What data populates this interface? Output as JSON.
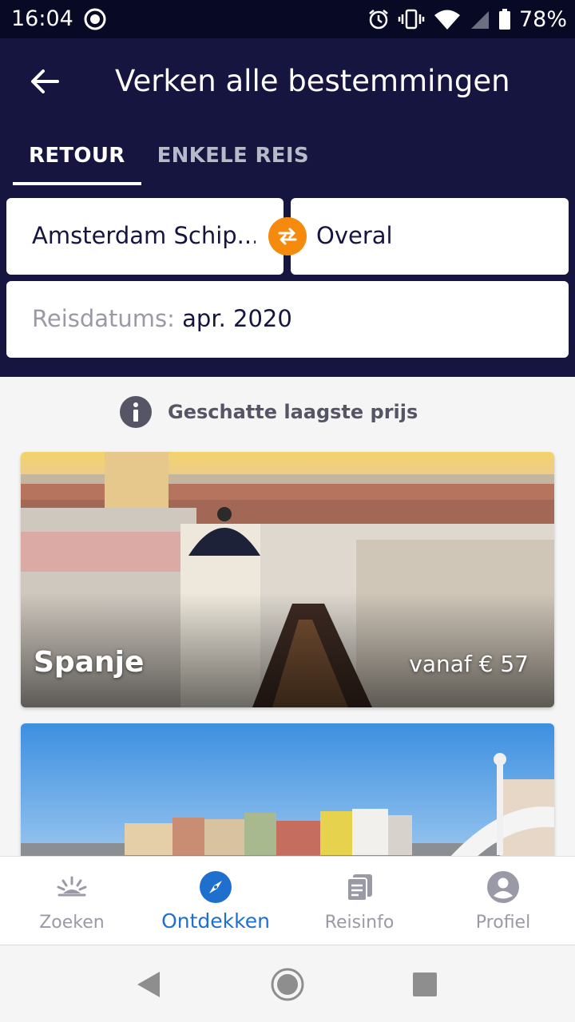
{
  "status_bar": {
    "time": "16:04",
    "battery_percent": "78%",
    "icons": [
      "sync-icon",
      "alarm-icon",
      "vibrate-icon",
      "wifi-icon",
      "signal-icon",
      "battery-icon"
    ]
  },
  "header": {
    "title": "Verken alle bestemmingen",
    "tabs": [
      {
        "label": "RETOUR",
        "active": true
      },
      {
        "label": "ENKELE REIS",
        "active": false
      }
    ]
  },
  "search": {
    "origin": "Amsterdam Schip...",
    "destination": "Overal",
    "date_label": "Reisdatums:",
    "date_value": "apr. 2020"
  },
  "info": {
    "text": "Geschatte laagste prijs"
  },
  "destinations": [
    {
      "name": "Spanje",
      "price": "vanaf € 57"
    },
    {
      "name": "",
      "price": ""
    }
  ],
  "bottom_nav": [
    {
      "label": "Zoeken",
      "icon": "sunrise-icon",
      "active": false
    },
    {
      "label": "Ontdekken",
      "icon": "compass-icon",
      "active": true
    },
    {
      "label": "Reisinfo",
      "icon": "documents-icon",
      "active": false
    },
    {
      "label": "Profiel",
      "icon": "person-icon",
      "active": false
    }
  ],
  "colors": {
    "header_bg": "#15153f",
    "status_bg": "#080924",
    "accent_orange": "#f58a0c",
    "nav_active_blue": "#1f6fcf",
    "nav_inactive_gray": "#9a9aa6"
  }
}
